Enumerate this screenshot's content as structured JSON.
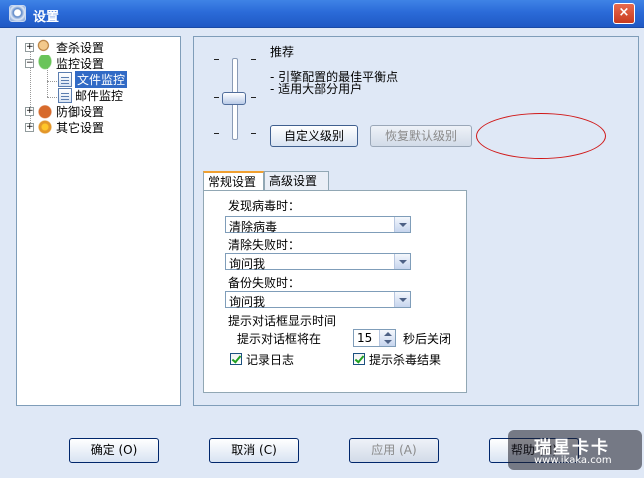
{
  "window": {
    "title": "设置",
    "close_glyph": "×"
  },
  "tree": {
    "items": [
      {
        "label": "查杀设置",
        "expander": "+"
      },
      {
        "label": "监控设置",
        "expander": "−"
      },
      {
        "label": "文件监控",
        "selected": true
      },
      {
        "label": "邮件监控"
      },
      {
        "label": "防御设置",
        "expander": "+"
      },
      {
        "label": "其它设置",
        "expander": "+"
      }
    ]
  },
  "level": {
    "title": "推荐",
    "lines": [
      "- 引擎配置的最佳平衡点",
      "- 适用大部分用户"
    ],
    "tick_glyph": "-",
    "custom_button": "自定义级别",
    "restore_button": "恢复默认级别",
    "slider_position": "middle"
  },
  "tabs": [
    {
      "label": "常规设置",
      "active": true
    },
    {
      "label": "高级设置",
      "active": false
    }
  ],
  "general": {
    "found_virus_label": "发现病毒时：",
    "found_virus_value": "清除病毒",
    "clean_fail_label": "清除失败时：",
    "clean_fail_value": "询问我",
    "backup_fail_label": "备份失败时：",
    "backup_fail_value": "询问我",
    "dialog_time_label": "提示对话框显示时间",
    "dialog_close_prefix": "提示对话框将在",
    "dialog_close_seconds": "15",
    "dialog_close_suffix": "秒后关闭",
    "log_checkbox_label": "记录日志",
    "log_checked": true,
    "result_checkbox_label": "提示杀毒结果",
    "result_checked": true
  },
  "buttons": {
    "ok": "确定 (O)",
    "cancel": "取消 (C)",
    "apply": "应用 (A)",
    "help": "帮助 (H)"
  },
  "watermark": {
    "brand": "瑞星卡卡",
    "url": "www.ikaka.com"
  },
  "colors": {
    "titlebar": "#2b6bd8",
    "selection": "#316ac5",
    "highlight_oval": "#d01818"
  }
}
